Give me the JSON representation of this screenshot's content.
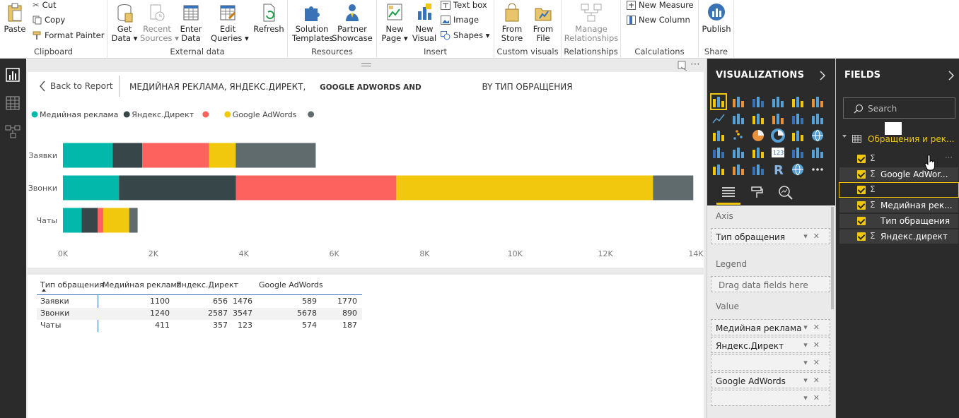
{
  "ribbon": {
    "clipboard": {
      "label": "Clipboard",
      "paste": "Paste",
      "cut": "Cut",
      "copy": "Copy",
      "format_painter": "Format Painter"
    },
    "external_data": {
      "label": "External data",
      "get_data": [
        "Get",
        "Data ▾"
      ],
      "recent_sources": [
        "Recent",
        "Sources ▾"
      ],
      "enter_data": [
        "Enter",
        "Data"
      ],
      "edit_queries": [
        "Edit",
        "Queries ▾"
      ],
      "refresh": "Refresh"
    },
    "resources": {
      "label": "Resources",
      "solution_templates": [
        "Solution",
        "Templates"
      ],
      "partner_showcase": [
        "Partner",
        "Showcase"
      ]
    },
    "insert": {
      "label": "Insert",
      "new_page": [
        "New",
        "Page ▾"
      ],
      "new_visual": [
        "New",
        "Visual"
      ],
      "text_box": "Text box",
      "image": "Image",
      "shapes": "Shapes ▾"
    },
    "custom_visuals": {
      "label": "Custom visuals",
      "from_store": [
        "From",
        "Store"
      ],
      "from_file": [
        "From",
        "File"
      ]
    },
    "relationships": {
      "label": "Relationships",
      "manage": [
        "Manage",
        "Relationships"
      ]
    },
    "calculations": {
      "label": "Calculations",
      "new_measure": "New Measure",
      "new_column": "New Column"
    },
    "share": {
      "label": "Share",
      "publish": "Publish"
    }
  },
  "report": {
    "back": "Back to Report",
    "title_1": "МЕДИЙНАЯ РЕКЛАМА, ЯНДЕКС.ДИРЕКТ,",
    "title_2": "GOOGLE ADWORDS AND",
    "title_3": "BY ТИП ОБРАЩЕНИЯ",
    "legend": [
      "Медийная реклама",
      "Яндекс.Директ",
      "",
      "Google AdWords",
      ""
    ]
  },
  "chart_data": {
    "type": "bar",
    "orientation": "horizontal",
    "stacked": true,
    "categories": [
      "Заявки",
      "Звонки",
      "Чаты"
    ],
    "series": [
      {
        "name": "Медийная реклама",
        "color": "#01b8aa",
        "values": [
          1100,
          1240,
          411
        ]
      },
      {
        "name": "Яндекс.Директ",
        "color": "#374649",
        "values": [
          656,
          2587,
          357
        ]
      },
      {
        "name": "",
        "color": "#fd625e",
        "values": [
          1476,
          3547,
          123
        ]
      },
      {
        "name": "Google AdWords",
        "color": "#f2c80f",
        "values": [
          589,
          5678,
          574
        ]
      },
      {
        "name": "",
        "color": "#5f6b6d",
        "values": [
          1770,
          890,
          187
        ]
      }
    ],
    "xlim": [
      0,
      14000
    ],
    "xticks": [
      "0K",
      "2K",
      "4K",
      "6K",
      "8K",
      "10K",
      "12K",
      "14K"
    ],
    "legend_position": "top-left",
    "grid": false
  },
  "table": {
    "headers": [
      "Тип обращения",
      "Медийная реклама",
      "Яндекс.Директ",
      "",
      "Google AdWords",
      ""
    ],
    "rows": [
      [
        "Заявки",
        "1100",
        "656",
        "1476",
        "589",
        "1770"
      ],
      [
        "Звонки",
        "1240",
        "2587",
        "3547",
        "5678",
        "890"
      ],
      [
        "Чаты",
        "411",
        "357",
        "123",
        "574",
        "187"
      ]
    ]
  },
  "visualizations": {
    "title": "VISUALIZATIONS",
    "axis_label": "Axis",
    "axis_field": "Тип обращения",
    "legend_label": "Legend",
    "legend_placeholder": "Drag data fields here",
    "value_label": "Value",
    "values": [
      "Медийная реклама",
      "Яндекс.Директ",
      "",
      "Google AdWords",
      ""
    ]
  },
  "fields": {
    "title": "FIELDS",
    "search_placeholder": "Search",
    "table_name": "Обращения и рек...",
    "items": [
      "",
      "Google AdWor...",
      "",
      "Медийная рек...",
      "Тип обращения",
      "Яндекс.директ"
    ]
  },
  "colors": {
    "accent": "#f2c80f",
    "dark_pane": "#2b2b2b",
    "teal": "#01b8aa",
    "dark": "#374649",
    "red": "#fd625e",
    "yellow": "#f2c80f",
    "gray": "#5f6b6d"
  }
}
